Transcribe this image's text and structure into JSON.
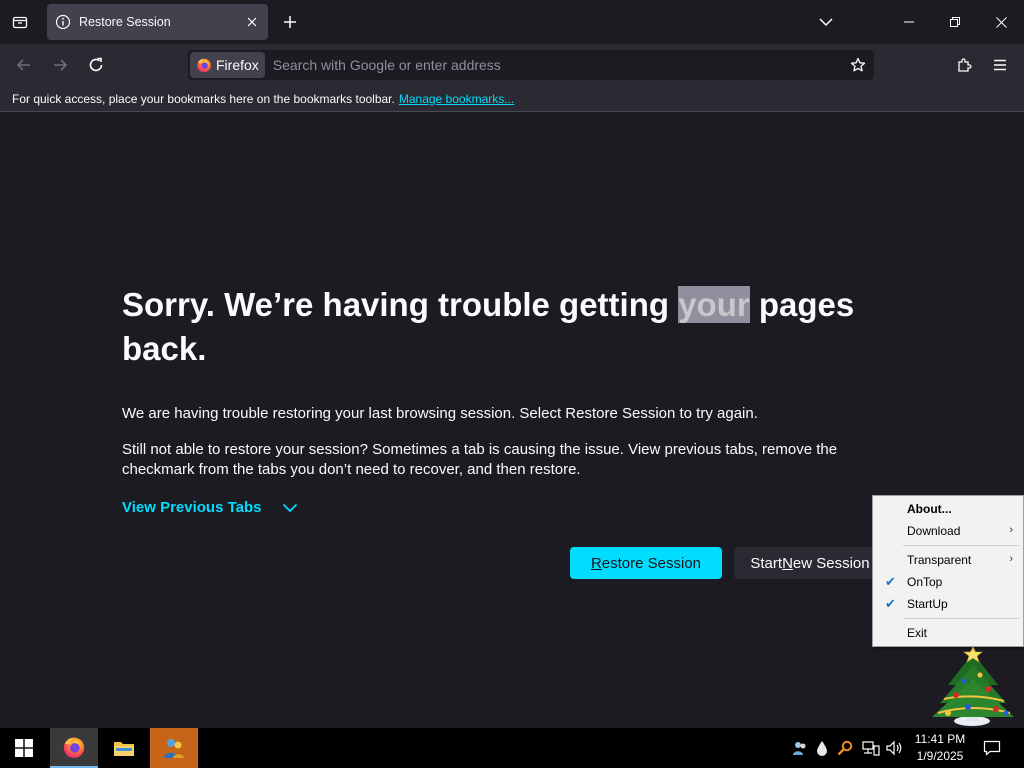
{
  "tab": {
    "title": "Restore Session"
  },
  "urlbar": {
    "identity_label": "Firefox",
    "placeholder": "Search with Google or enter address"
  },
  "bookmarks_bar": {
    "message": "For quick access, place your bookmarks here on the bookmarks toolbar.",
    "manage_link": "Manage bookmarks..."
  },
  "page": {
    "heading_before": "Sorry. We’re having trouble getting ",
    "heading_highlight": "your",
    "heading_after": " pages back.",
    "para1": "We are having trouble restoring your last browsing session. Select Restore Session to try again.",
    "para2": "Still not able to restore your session? Sometimes a tab is causing the issue. View previous tabs, remove the checkmark from the tabs you don’t need to recover, and then restore.",
    "view_previous_tabs": "View Previous Tabs",
    "restore_button_pre": "",
    "restore_button_accel": "R",
    "restore_button_post": "estore Session",
    "new_session_pre": "Start ",
    "new_session_accel": "N",
    "new_session_post": "ew Session"
  },
  "context_menu": {
    "items": [
      {
        "label": "About...",
        "bold": true,
        "submenu": false,
        "checked": false
      },
      {
        "label": "Download",
        "bold": false,
        "submenu": true,
        "checked": false
      },
      {
        "label": "Transparent",
        "bold": false,
        "submenu": true,
        "checked": false
      },
      {
        "label": "OnTop",
        "bold": false,
        "submenu": false,
        "checked": true
      },
      {
        "label": "StartUp",
        "bold": false,
        "submenu": false,
        "checked": true
      },
      {
        "label": "Exit",
        "bold": false,
        "submenu": false,
        "checked": false
      }
    ]
  },
  "taskbar": {
    "time": "11:41 PM",
    "date": "1/9/2025"
  },
  "colors": {
    "accent": "#00ddff",
    "tab_bg": "#42414d",
    "content_bg": "#1c1b22"
  }
}
